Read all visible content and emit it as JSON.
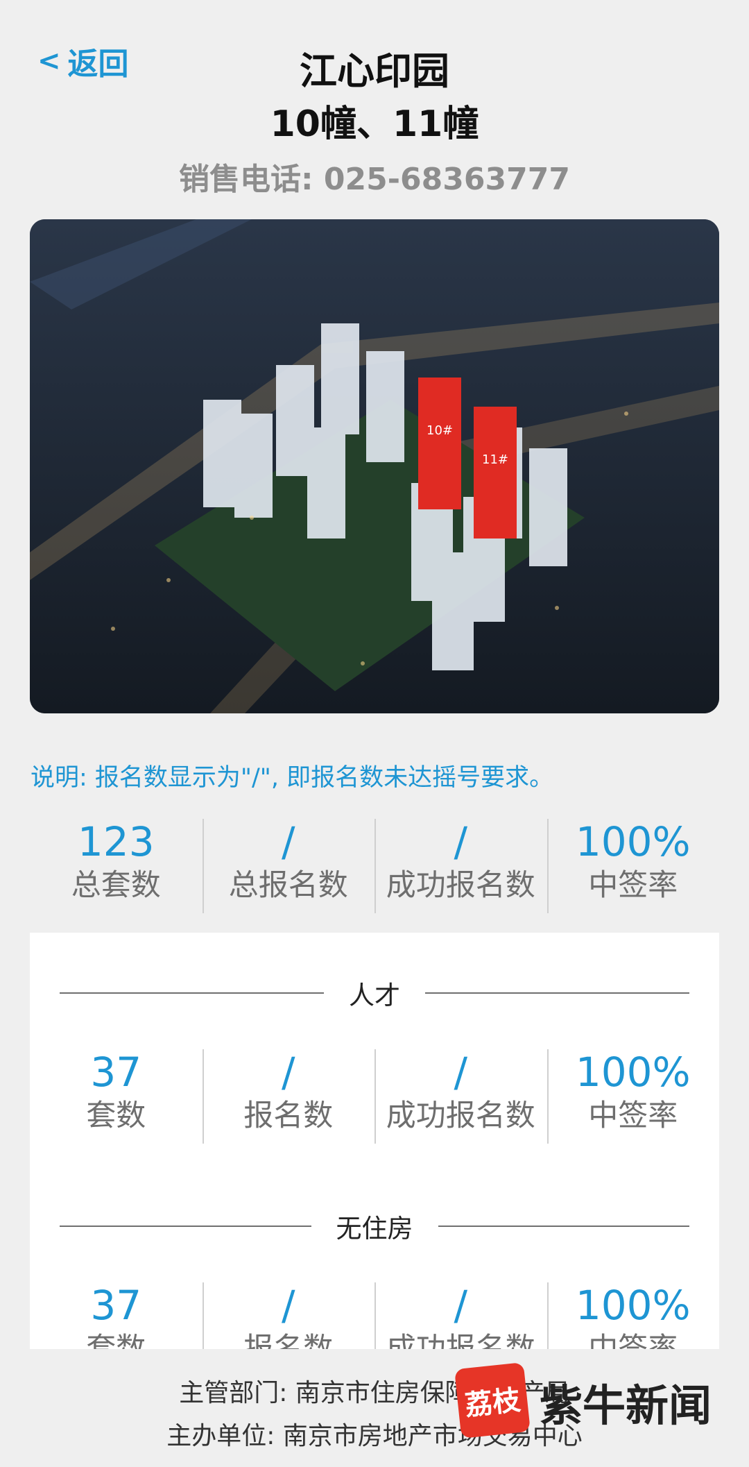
{
  "header": {
    "back_label": "返回",
    "title_line1": "江心印园",
    "title_line2": "10幢、11幢",
    "phone": "销售电话: 025-68363777"
  },
  "hero": {
    "building_labels": [
      "10#",
      "11#"
    ],
    "highlight_color": "#e02b23"
  },
  "note": "说明: 报名数显示为\"/\", 即报名数未达摇号要求。",
  "summary": [
    {
      "value": "123",
      "label": "总套数"
    },
    {
      "value": "/",
      "label": "总报名数"
    },
    {
      "value": "/",
      "label": "成功报名数"
    },
    {
      "value": "100%",
      "label": "中签率"
    }
  ],
  "sections": [
    {
      "title": "人才",
      "stats": [
        {
          "value": "37",
          "label": "套数"
        },
        {
          "value": "/",
          "label": "报名数"
        },
        {
          "value": "/",
          "label": "成功报名数"
        },
        {
          "value": "100%",
          "label": "中签率"
        }
      ]
    },
    {
      "title": "无住房",
      "stats": [
        {
          "value": "37",
          "label": "套数"
        },
        {
          "value": "/",
          "label": "报名数"
        },
        {
          "value": "/",
          "label": "成功报名数"
        },
        {
          "value": "100%",
          "label": "中签率"
        }
      ]
    }
  ],
  "footer": {
    "line1": "主管部门: 南京市住房保障和房产局",
    "line2": "主办单位: 南京市房地产市场交易中心"
  },
  "watermark": {
    "badge": "荔枝",
    "text": "紫牛新闻"
  },
  "colors": {
    "accent": "#1e95d3",
    "muted": "#8d8d8d",
    "background": "#efefef"
  }
}
